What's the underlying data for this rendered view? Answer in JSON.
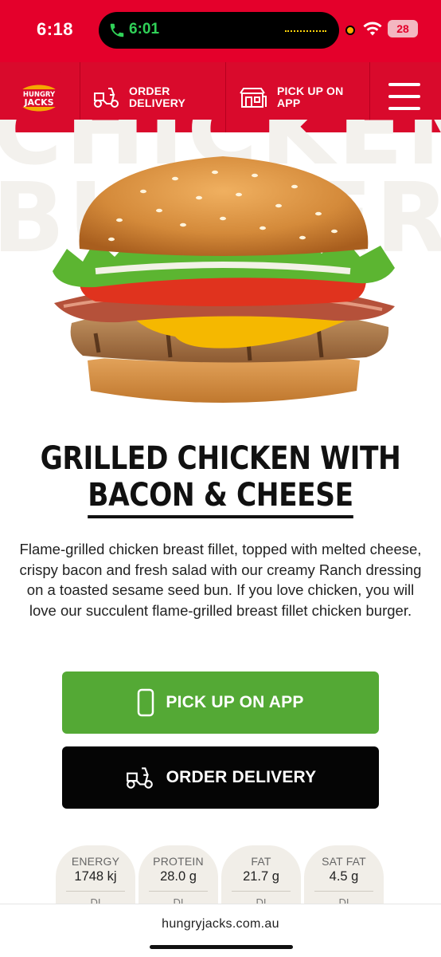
{
  "status_bar": {
    "time": "6:18",
    "call_time": "6:01",
    "battery": "28"
  },
  "nav": {
    "logo_text": "HUNGRY JACKS",
    "delivery_label": "ORDER DELIVERY",
    "pickup_label": "PICK UP ON APP"
  },
  "watermark": {
    "line1": "CHICKEN",
    "line2": "BURGERS"
  },
  "product": {
    "title_line1": "GRILLED CHICKEN WITH",
    "title_line2": "BACON & CHEESE",
    "description": "Flame-grilled chicken breast fillet, topped with melted cheese, crispy bacon and fresh salad with our creamy Ranch dressing on a toasted sesame seed bun. If you love chicken, you will love our succulent flame-grilled breast fillet chicken burger."
  },
  "buttons": {
    "pickup_label": "PICK UP ON APP",
    "delivery_label": "ORDER DELIVERY"
  },
  "nutrition": [
    {
      "label": "ENERGY",
      "value": "1748 kj",
      "di": "DI"
    },
    {
      "label": "PROTEIN",
      "value": "28.0 g",
      "di": "DI"
    },
    {
      "label": "FAT",
      "value": "21.7 g",
      "di": "DI"
    },
    {
      "label": "SAT FAT",
      "value": "4.5 g",
      "di": "DI"
    }
  ],
  "browser": {
    "url": "hungryjacks.com.au"
  },
  "colors": {
    "brand_red": "#d90a2c",
    "status_red": "#e4002b",
    "pickup_green": "#54a935",
    "delivery_black": "#050505"
  }
}
